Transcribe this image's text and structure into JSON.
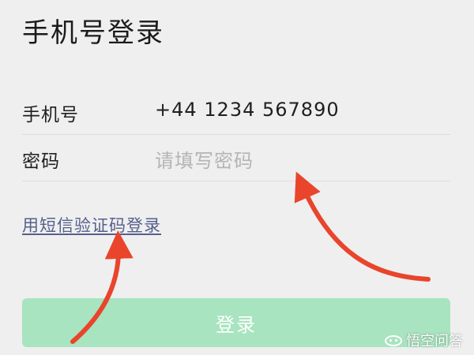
{
  "page": {
    "title": "手机号登录"
  },
  "form": {
    "phone": {
      "label": "手机号",
      "value": "+44 1234 567890"
    },
    "password": {
      "label": "密码",
      "placeholder": "请填写密码",
      "value": ""
    },
    "sms_login_link": "用短信验证码登录",
    "login_button": "登录"
  },
  "annotations": {
    "arrow_color": "#e8452c"
  },
  "watermark": {
    "text": "悟空问答"
  },
  "colors": {
    "background": "#efefef",
    "button_disabled": "#a8e4bf",
    "link": "#55608c"
  }
}
